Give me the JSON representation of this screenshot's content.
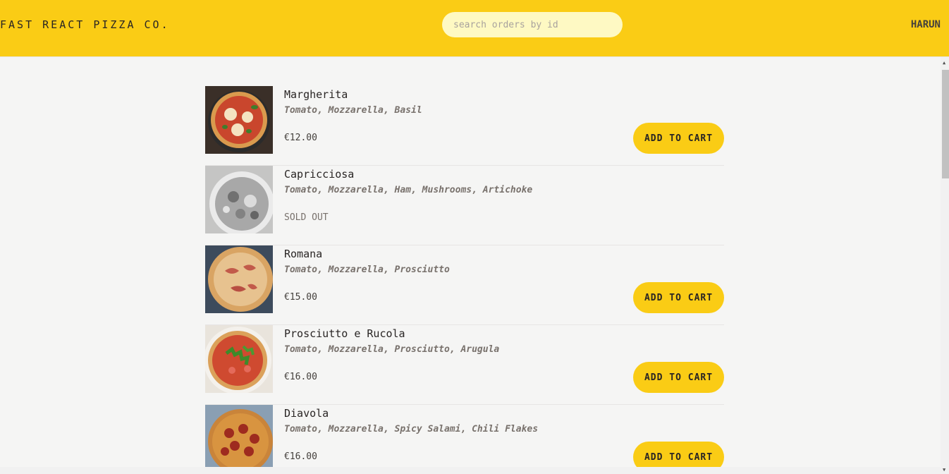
{
  "header": {
    "logo": "Fast React Pizza Co.",
    "search_placeholder": "search orders by id",
    "username": "Harun"
  },
  "menu": [
    {
      "name": "Margherita",
      "ingredients": "Tomato, Mozzarella, Basil",
      "price": "€12.00",
      "sold_out": false,
      "button": "Add to cart"
    },
    {
      "name": "Capricciosa",
      "ingredients": "Tomato, Mozzarella, Ham, Mushrooms, Artichoke",
      "status": "Sold out",
      "sold_out": true
    },
    {
      "name": "Romana",
      "ingredients": "Tomato, Mozzarella, Prosciutto",
      "price": "€15.00",
      "sold_out": false,
      "button": "Add to cart"
    },
    {
      "name": "Prosciutto e Rucola",
      "ingredients": "Tomato, Mozzarella, Prosciutto, Arugula",
      "price": "€16.00",
      "sold_out": false,
      "button": "Add to cart"
    },
    {
      "name": "Diavola",
      "ingredients": "Tomato, Mozzarella, Spicy Salami, Chili Flakes",
      "price": "€16.00",
      "sold_out": false,
      "button": "Add to cart"
    }
  ],
  "colors": {
    "accent": "#facc15",
    "background": "#f5f5f4",
    "search_bg": "#fef9c3"
  },
  "icons": {
    "scroll_up": "scroll-up-arrow-icon",
    "scroll_down": "scroll-down-arrow-icon"
  }
}
